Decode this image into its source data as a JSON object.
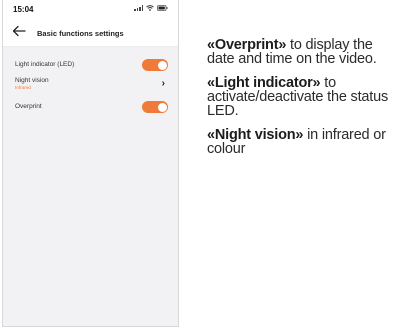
{
  "status_bar": {
    "time": "15:04"
  },
  "header": {
    "title": "Basic functions settings"
  },
  "settings": [
    {
      "label": "Light indicator (LED)",
      "control": "toggle",
      "enabled": true
    },
    {
      "label": "Night vision",
      "sublabel": "Infrared",
      "control": "chevron"
    },
    {
      "label": "Overprint",
      "control": "toggle",
      "enabled": true
    }
  ],
  "annotations": [
    {
      "title": "«Overprint»",
      "text": " to display the date and time on the video."
    },
    {
      "title": "«Light indicator»",
      "text": " to activate/deactivate the status LED."
    },
    {
      "title": "«Night vision»",
      "text": " in infrared or colour"
    }
  ],
  "colors": {
    "accent": "#f07a3a",
    "screen_bg": "#f2f2f4",
    "header_bg": "#ffffff"
  },
  "icons": [
    "back-arrow-icon",
    "signal-icon",
    "wifi-icon",
    "battery-icon",
    "chevron-right-icon"
  ]
}
